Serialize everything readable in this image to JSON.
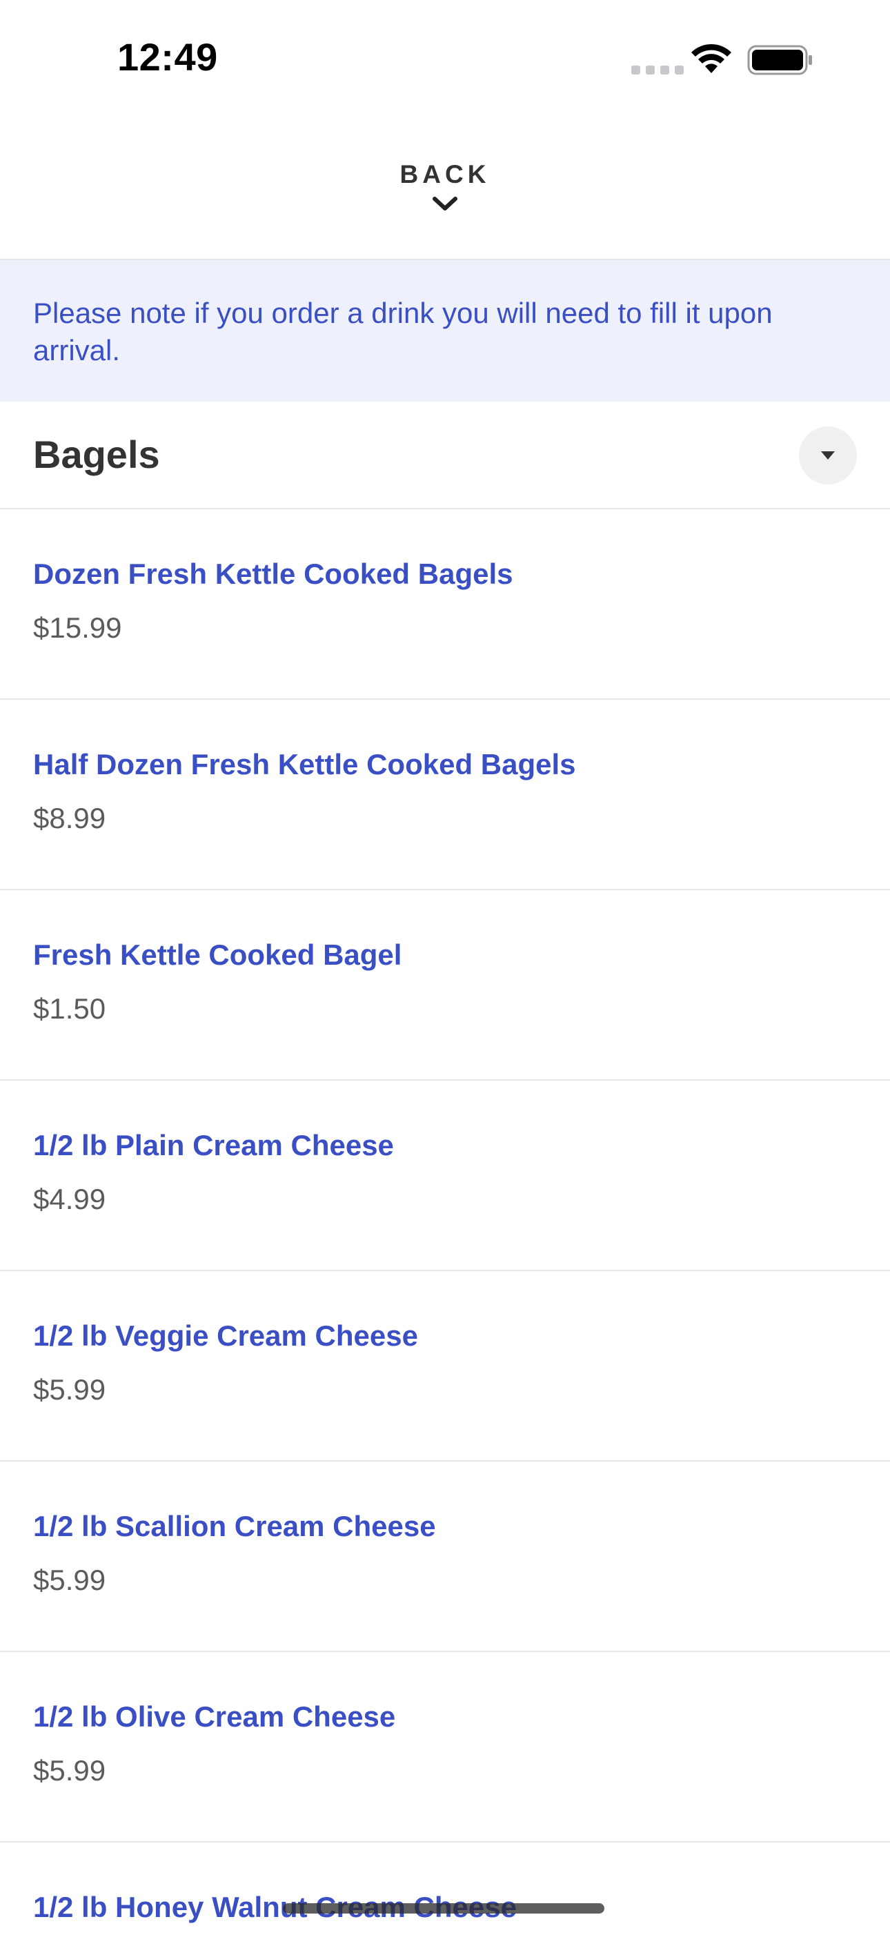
{
  "status_bar": {
    "time": "12:49",
    "wifi_icon": "wifi-icon",
    "battery_icon": "battery-icon"
  },
  "header": {
    "back_label": "BACK",
    "back_icon": "chevron-down-icon"
  },
  "notice": {
    "text": "Please note if you order a drink you will need to fill it upon arrival."
  },
  "section": {
    "title": "Bagels",
    "toggle_icon": "caret-down-icon"
  },
  "items": [
    {
      "name": "Dozen Fresh Kettle Cooked Bagels",
      "price": "$15.99"
    },
    {
      "name": "Half Dozen Fresh Kettle Cooked Bagels",
      "price": "$8.99"
    },
    {
      "name": "Fresh Kettle Cooked Bagel",
      "price": "$1.50"
    },
    {
      "name": "1/2 lb Plain Cream Cheese",
      "price": "$4.99"
    },
    {
      "name": "1/2 lb Veggie Cream Cheese",
      "price": "$5.99"
    },
    {
      "name": "1/2 lb Scallion Cream Cheese",
      "price": "$5.99"
    },
    {
      "name": "1/2 lb Olive Cream Cheese",
      "price": "$5.99"
    },
    {
      "name": "1/2 lb Honey Walnut Cream Cheese",
      "price": ""
    }
  ],
  "colors": {
    "accent": "#3b4fc4",
    "notice_bg": "#eef0fb",
    "divider": "#e6e6e6",
    "price_text": "#5b5b5b",
    "heading_text": "#333333"
  }
}
